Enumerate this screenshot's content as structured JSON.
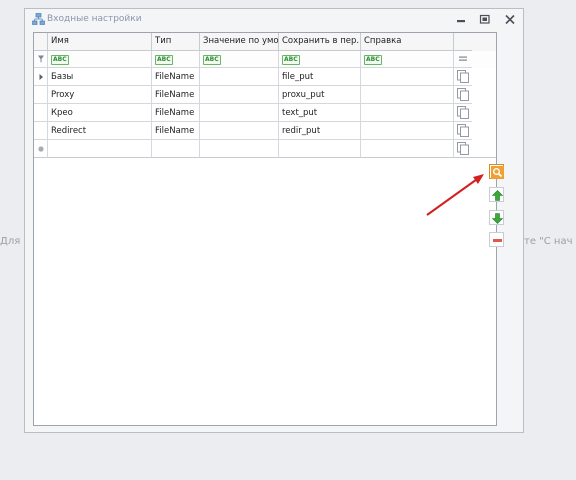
{
  "background": {
    "left_text": "Для",
    "right_text": "те \"С нач"
  },
  "window": {
    "title": "Входные настройки"
  },
  "grid": {
    "columns": [
      "Имя",
      "Тип",
      "Значение по умо...",
      "Сохранить в пер...",
      "Справка"
    ],
    "filter_placeholder": "ABC",
    "rows": [
      {
        "name": "Базы",
        "type": "FileName",
        "default": "",
        "save_to": "file_put",
        "help": ""
      },
      {
        "name": "Proxy",
        "type": "FileName",
        "default": "",
        "save_to": "proxu_put",
        "help": ""
      },
      {
        "name": "Креo",
        "type": "FileName",
        "default": "",
        "save_to": "text_put",
        "help": ""
      },
      {
        "name": "Redirect",
        "type": "FileName",
        "default": "",
        "save_to": "redir_put",
        "help": ""
      }
    ]
  },
  "side_buttons": [
    "search-icon",
    "arrow-up-icon",
    "arrow-down-icon",
    "remove-icon"
  ],
  "colors": {
    "accent_orange": "#f0a030",
    "up_green": "#3aa83a",
    "remove_red": "#e05a4a",
    "annotation_arrow": "#d42020"
  }
}
